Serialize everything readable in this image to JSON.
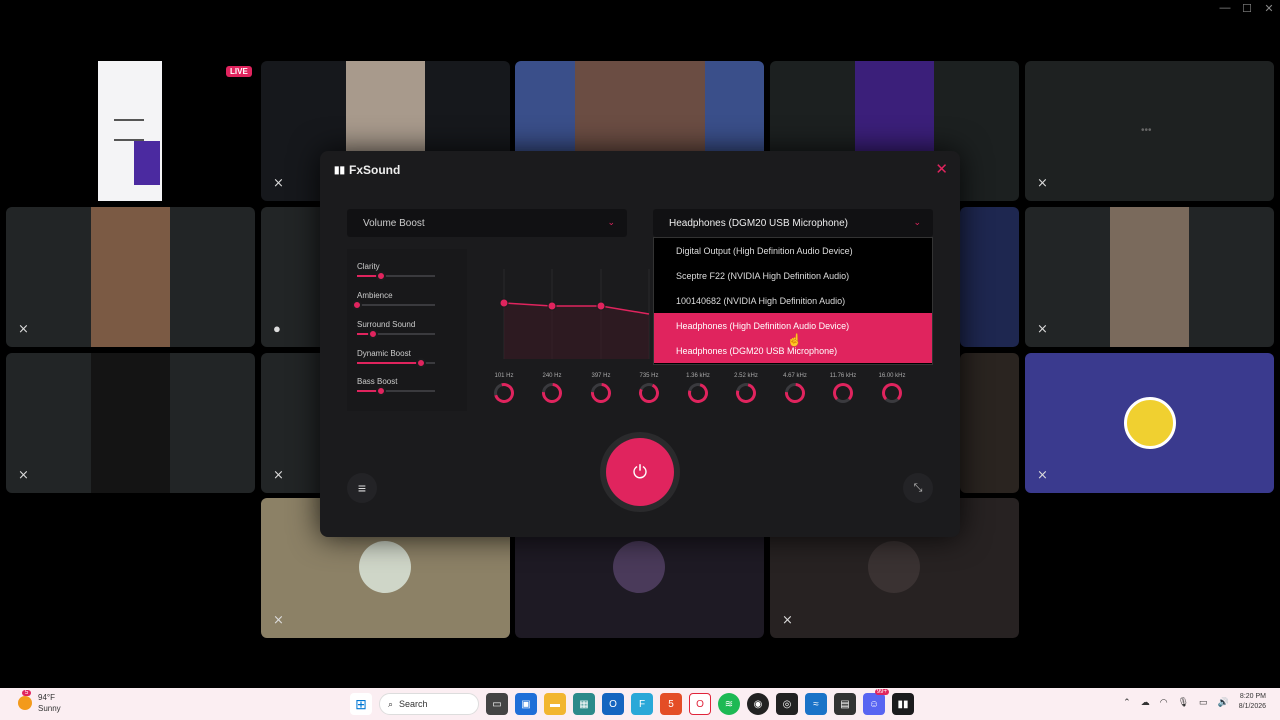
{
  "window": {
    "minimize": "—",
    "maximize": "☐",
    "close": "✕"
  },
  "call": {
    "live_badge": "LIVE",
    "more_dots": "•••"
  },
  "fxsound": {
    "title": "FxSound",
    "preset": "Volume Boost",
    "output": "Headphones (DGM20 USB Microphone)",
    "effects": [
      {
        "label": "Clarity",
        "value": 0.3
      },
      {
        "label": "Ambience",
        "value": 0.0
      },
      {
        "label": "Surround Sound",
        "value": 0.2
      },
      {
        "label": "Dynamic Boost",
        "value": 0.82
      },
      {
        "label": "Bass Boost",
        "value": 0.3
      }
    ],
    "bands": [
      "101 Hz",
      "240 Hz",
      "397 Hz",
      "735 Hz",
      "1.36 kHz",
      "2.52 kHz",
      "4.67 kHz",
      "11.76 kHz",
      "16.00 kHz"
    ],
    "devices": [
      "Digital Output (High Definition Audio Device)",
      "Sceptre F22 (NVIDIA High Definition Audio)",
      "100140682 (NVIDIA High Definition Audio)",
      "Headphones (High Definition Audio Device)",
      "Headphones (DGM20 USB Microphone)"
    ]
  },
  "taskbar": {
    "weather_temp": "94°F",
    "weather_desc": "Sunny",
    "search": "Search",
    "time": "8:20 PM",
    "date": "8/1/2026",
    "badge": "5"
  }
}
